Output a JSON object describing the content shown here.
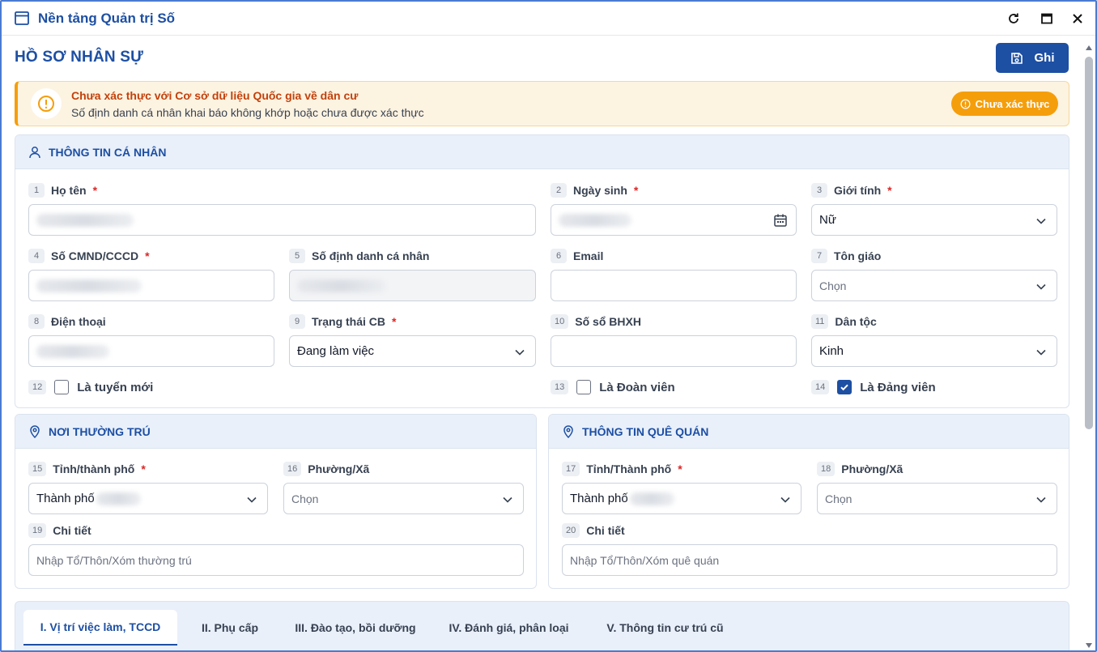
{
  "titlebar": {
    "title": "Nền tảng Quản trị Số",
    "icons": [
      "window-icon",
      "refresh-icon",
      "maximize-icon",
      "close-icon"
    ]
  },
  "page": {
    "title": "HỒ SƠ NHÂN SỰ",
    "save_label": "Ghi"
  },
  "alert": {
    "title": "Chưa xác thực với Cơ sở dữ liệu Quốc gia về dân cư",
    "description": "Số định danh cá nhân khai báo không khớp hoặc chưa được xác thực",
    "button_label": "Chưa xác thực"
  },
  "personal": {
    "header": "THÔNG TIN CÁ NHÂN",
    "fields": {
      "ho_ten": {
        "num": "1",
        "label": "Họ tên",
        "req": "*"
      },
      "ngay_sinh": {
        "num": "2",
        "label": "Ngày sinh",
        "req": "*"
      },
      "gioi_tinh": {
        "num": "3",
        "label": "Giới tính",
        "req": "*",
        "value": "Nữ"
      },
      "cmnd": {
        "num": "4",
        "label": "Số CMND/CCCD",
        "req": "*"
      },
      "dinh_danh": {
        "num": "5",
        "label": "Số định danh cá nhân"
      },
      "email": {
        "num": "6",
        "label": "Email"
      },
      "ton_giao": {
        "num": "7",
        "label": "Tôn giáo",
        "value": "Chọn"
      },
      "dien_thoai": {
        "num": "8",
        "label": "Điện thoại"
      },
      "trang_thai": {
        "num": "9",
        "label": "Trạng thái CB",
        "req": "*",
        "value": "Đang làm việc"
      },
      "bhxh": {
        "num": "10",
        "label": "Số sổ BHXH"
      },
      "dan_toc": {
        "num": "11",
        "label": "Dân tộc",
        "value": "Kinh"
      }
    },
    "checks": {
      "tuyen_moi": {
        "num": "12",
        "label": "Là tuyển mới",
        "checked": false
      },
      "doan_vien": {
        "num": "13",
        "label": "Là Đoàn viên",
        "checked": false
      },
      "dang_vien": {
        "num": "14",
        "label": "Là Đảng viên",
        "checked": true
      }
    }
  },
  "residence": {
    "header": "NƠI THƯỜNG TRÚ",
    "tinh": {
      "num": "15",
      "label": "Tỉnh/thành phố",
      "req": "*",
      "value": "Thành phố"
    },
    "phuong": {
      "num": "16",
      "label": "Phường/Xã",
      "value": "Chọn"
    },
    "chi_tiet": {
      "num": "19",
      "label": "Chi tiết",
      "placeholder": "Nhập Tổ/Thôn/Xóm thường trú"
    }
  },
  "hometown": {
    "header": "THÔNG TIN QUÊ QUÁN",
    "tinh": {
      "num": "17",
      "label": "Tỉnh/Thành phố",
      "req": "*",
      "value": "Thành phố"
    },
    "phuong": {
      "num": "18",
      "label": "Phường/Xã",
      "value": "Chọn"
    },
    "chi_tiet": {
      "num": "20",
      "label": "Chi tiết",
      "placeholder": "Nhập Tổ/Thôn/Xóm quê quán"
    }
  },
  "tabs": [
    {
      "label": "I. Vị trí việc làm, TCCD",
      "active": true
    },
    {
      "label": "II. Phụ cấp"
    },
    {
      "label": "III. Đào tạo, bồi dưỡng"
    },
    {
      "label": "IV. Đánh giá, phân loại"
    },
    {
      "label": "V. Thông tin cư trú cũ"
    }
  ],
  "colors": {
    "primary": "#1d4fa3",
    "warning": "#f59e0b",
    "warning_bg": "#fdf3e1",
    "section_bg": "#e9f0fa",
    "required": "#dc2626"
  }
}
